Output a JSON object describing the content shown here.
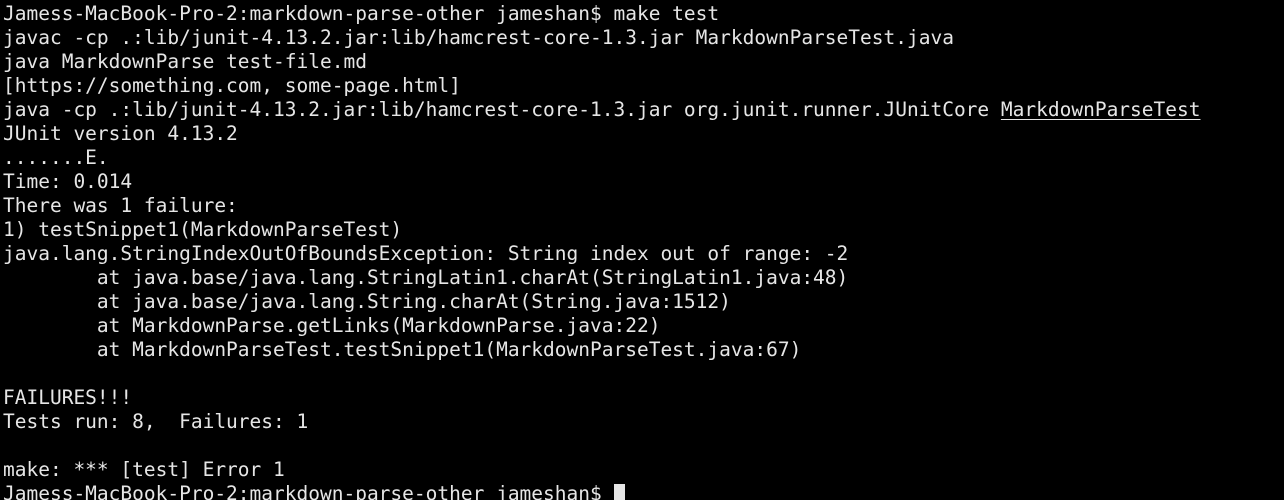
{
  "terminal": {
    "lines": [
      "Jamess-MacBook-Pro-2:markdown-parse-other jameshan$ make test",
      "javac -cp .:lib/junit-4.13.2.jar:lib/hamcrest-core-1.3.jar MarkdownParseTest.java",
      "java MarkdownParse test-file.md",
      "[https://something.com, some-page.html]",
      "java -cp .:lib/junit-4.13.2.jar:lib/hamcrest-core-1.3.jar org.junit.runner.JUnitCore ",
      "JUnit version 4.13.2",
      ".......E.",
      "Time: 0.014",
      "There was 1 failure:",
      "1) testSnippet1(MarkdownParseTest)",
      "java.lang.StringIndexOutOfBoundsException: String index out of range: -2",
      "        at java.base/java.lang.StringLatin1.charAt(StringLatin1.java:48)",
      "        at java.base/java.lang.String.charAt(String.java:1512)",
      "        at MarkdownParse.getLinks(MarkdownParse.java:22)",
      "        at MarkdownParseTest.testSnippet1(MarkdownParseTest.java:67)",
      "",
      "FAILURES!!!",
      "Tests run: 8,  Failures: 1",
      "",
      "make: *** [test] Error 1",
      "Jamess-MacBook-Pro-2:markdown-parse-other jameshan$ "
    ],
    "link_text": "MarkdownParseTest",
    "colors": {
      "background": "#000000",
      "foreground": "#e6e6e6"
    }
  }
}
